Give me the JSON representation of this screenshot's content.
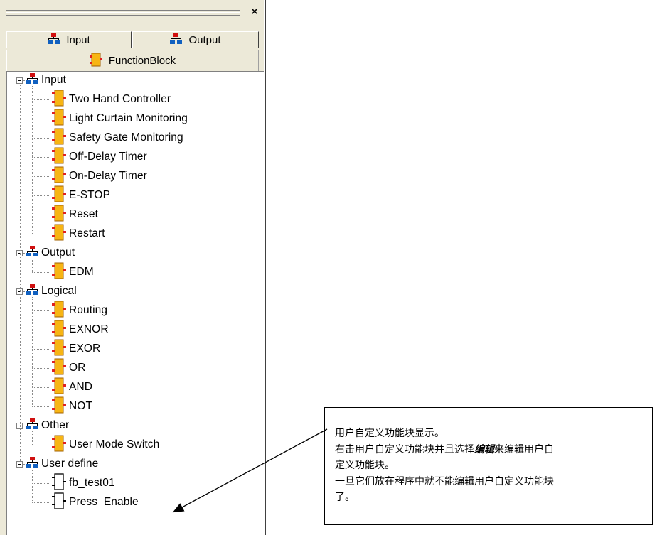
{
  "panel": {
    "close_glyph": "×",
    "tabs": {
      "input": "Input",
      "output": "Output",
      "function_block": "FunctionBlock"
    }
  },
  "tree": {
    "groups": [
      {
        "label": "Input",
        "items": [
          "Two Hand Controller",
          "Light Curtain Monitoring",
          "Safety Gate Monitoring",
          "Off-Delay Timer",
          "On-Delay Timer",
          "E-STOP",
          "Reset",
          "Restart"
        ]
      },
      {
        "label": "Output",
        "items": [
          "EDM"
        ]
      },
      {
        "label": "Logical",
        "items": [
          "Routing",
          "EXNOR",
          "EXOR",
          "OR",
          "AND",
          "NOT"
        ]
      },
      {
        "label": "Other",
        "items": [
          "User Mode Switch"
        ]
      },
      {
        "label": "User define",
        "items": [
          "fb_test01",
          "Press_Enable"
        ]
      }
    ]
  },
  "callout": {
    "line1": "用户自定义功能块显示。",
    "line2_a": "右击用户自定义功能块并且选择",
    "line2_em": "编辑",
    "line2_b": "来编辑用户自",
    "line3": "定义功能块。",
    "line4": "一旦它们放在程序中就不能编辑用户自定义功能块",
    "line5": "了。"
  },
  "icons": {
    "group": "network-group-icon",
    "block": "function-block-icon",
    "user_block": "user-function-block-icon"
  },
  "colors": {
    "panel_bg": "#ece9d8",
    "block_fill": "#f7b514",
    "block_pin": "#e02020",
    "group_red": "#d01010",
    "group_blue": "#1060c0"
  }
}
